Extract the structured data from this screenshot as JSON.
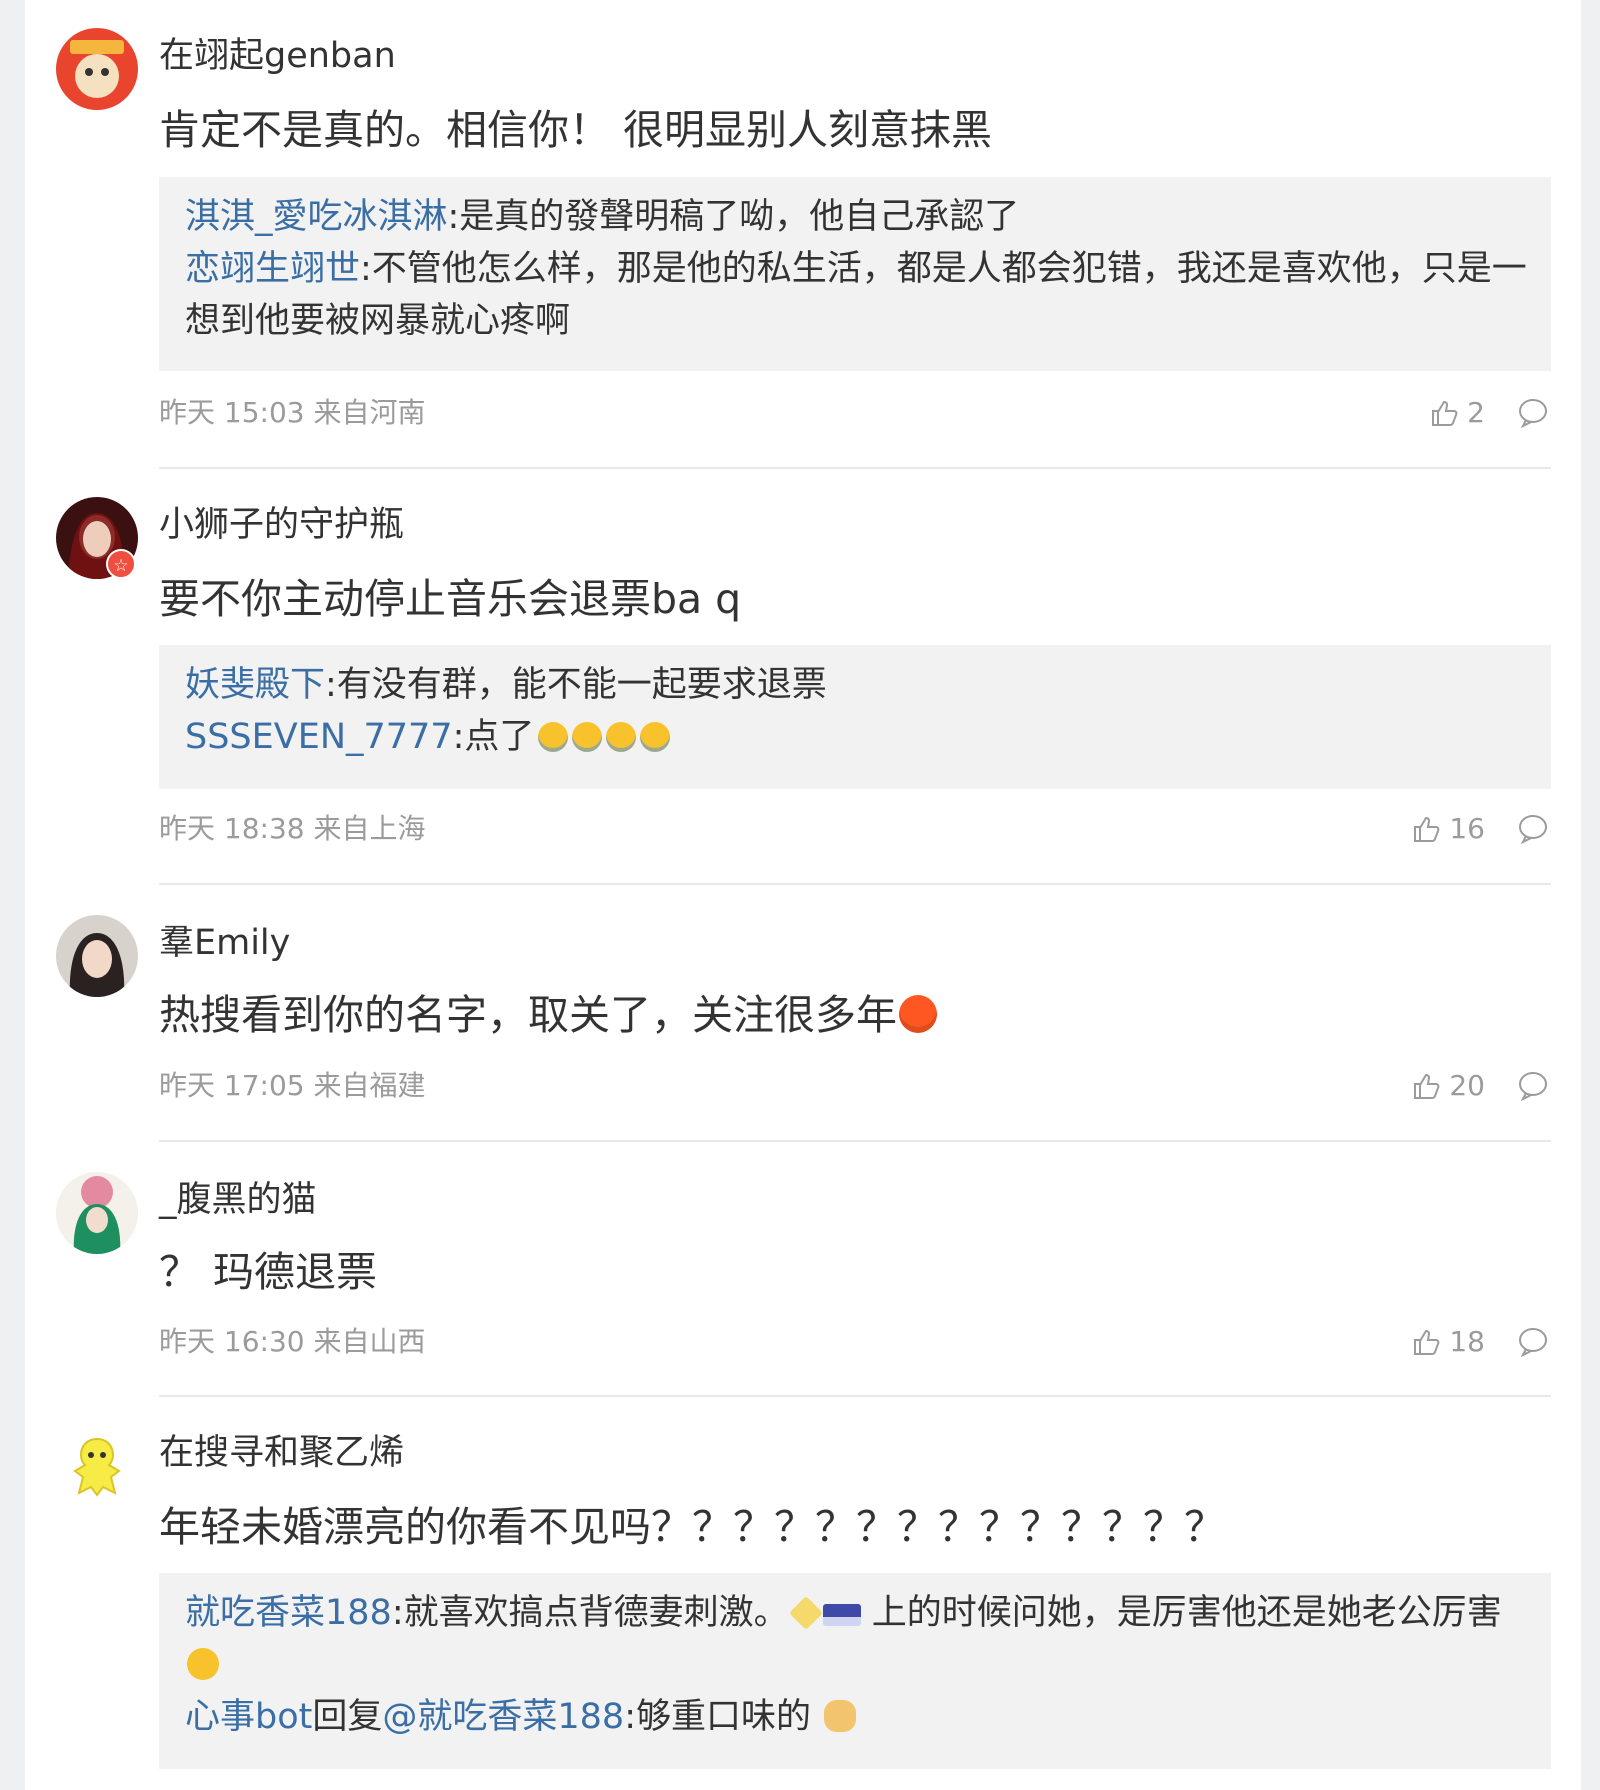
{
  "comments": [
    {
      "user": "在翊起genban",
      "text": "肯定不是真的。相信你！ 很明显别人刻意抹黑",
      "replies": [
        {
          "user": "淇淇_愛吃冰淇淋",
          "text": ":是真的發聲明稿了呦，他自己承認了"
        },
        {
          "user": "恋翊生翊世",
          "text": ":不管他怎么样，那是他的私生活，都是人都会犯错，我还是喜欢他，只是一想到他要被网暴就心疼啊"
        }
      ],
      "time": "昨天 15:03 来自河南",
      "likes": "2"
    },
    {
      "user": "小狮子的守护瓶",
      "text": "要不你主动停止音乐会退票ba q",
      "replies": [
        {
          "user": "妖斐殿下",
          "text": ":有没有群，能不能一起要求退票"
        },
        {
          "user": "SSSEVEN_7777",
          "text": ":点了"
        }
      ],
      "time": "昨天 18:38 来自上海",
      "likes": "16"
    },
    {
      "user": "羣Emily",
      "text": "热搜看到你的名字，取关了，关注很多年",
      "time": "昨天 17:05 来自福建",
      "likes": "20"
    },
    {
      "user": "_腹黑的猫",
      "text": "？ 玛德退票",
      "time": "昨天 16:30 来自山西",
      "likes": "18"
    },
    {
      "user": "在搜寻和聚乙烯",
      "text": "年轻未婚漂亮的你看不见吗？？？？？？？？？？？？？？",
      "replies": [
        {
          "user": "就吃香菜188",
          "text": ":就喜欢搞点背德妻刺激。",
          "text_after_emoji": "上的时候问她，是厉害他还是她老公厉害"
        },
        {
          "user": "心事bot",
          "reply_word": "回复",
          "mention": "@就吃香菜188",
          "text": ":够重口味的"
        }
      ]
    }
  ],
  "colors": {
    "link": "#3a6ea5",
    "meta": "#9b9b9b",
    "reply_bg": "#f2f2f2",
    "vip_badge": "#f04e3e"
  },
  "icons": [
    "thumbs-up-icon",
    "comment-bubble-icon"
  ]
}
